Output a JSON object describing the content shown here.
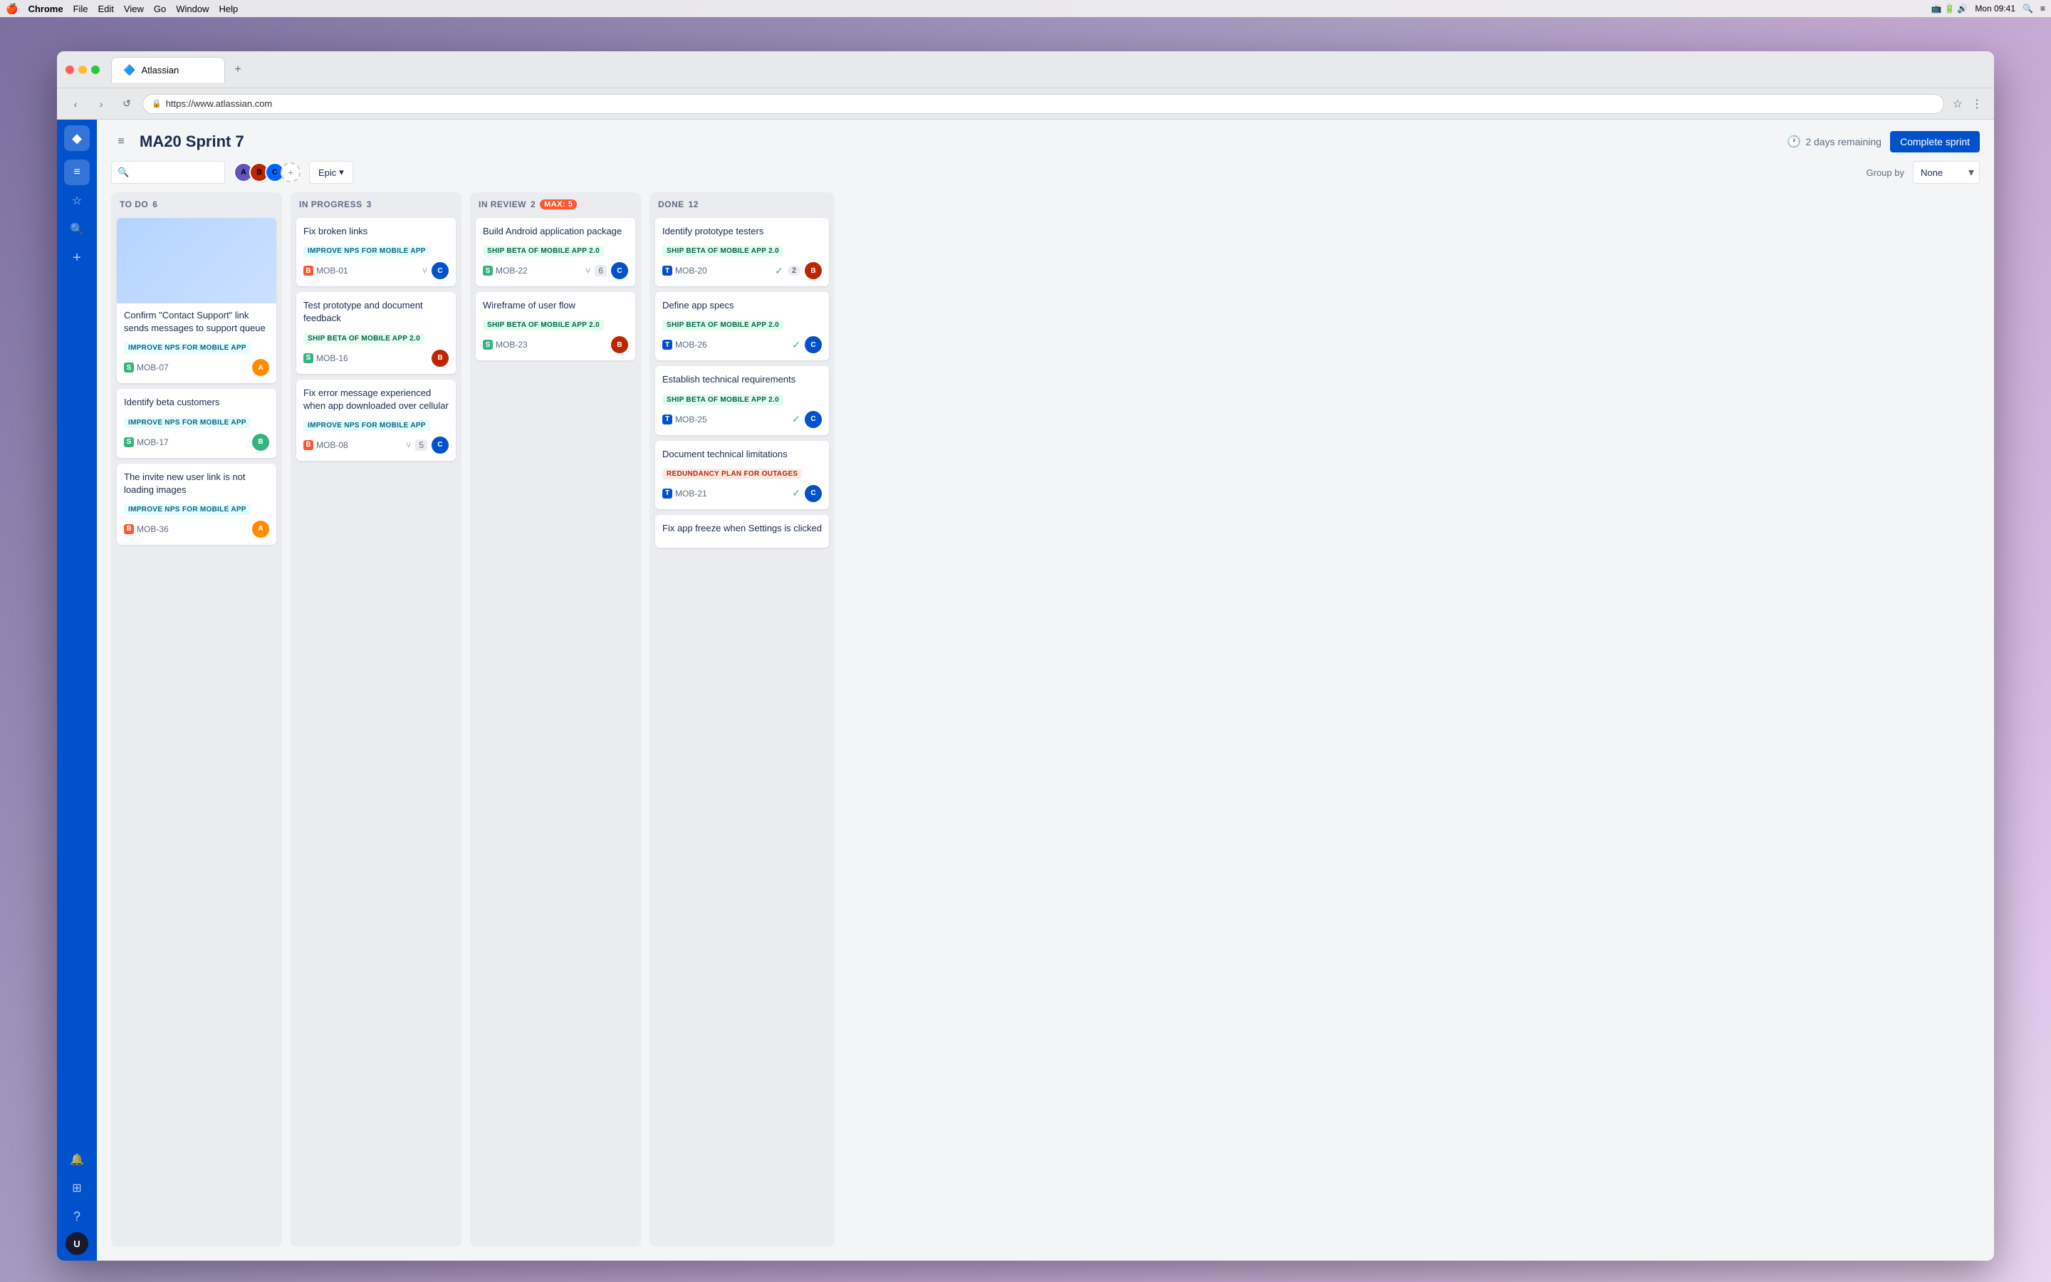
{
  "menubar": {
    "apple": "🍎",
    "app_name": "Chrome",
    "menus": [
      "File",
      "Edit",
      "View",
      "Go",
      "Window",
      "Help"
    ],
    "time": "Mon 09:41"
  },
  "browser": {
    "tab_label": "Atlassian",
    "tab_icon": "🔷",
    "url": "https://www.atlassian.com",
    "new_tab_label": "+"
  },
  "sprint": {
    "title": "MA20 Sprint 7",
    "remaining": "2 days remaining",
    "complete_btn": "Complete sprint",
    "group_by_label": "Group by",
    "group_by_value": "None",
    "epic_filter": "Epic"
  },
  "columns": {
    "todo": {
      "label": "TO DO",
      "count": "6"
    },
    "in_progress": {
      "label": "IN PROGRESS",
      "count": "3"
    },
    "in_review": {
      "label": "IN REVIEW",
      "count": "2",
      "max": "MAX: 5"
    },
    "done": {
      "label": "DONE",
      "count": "12"
    }
  },
  "todo_cards": [
    {
      "has_image": true,
      "title": "Confirm \"Contact Support\" link sends messages to support queue",
      "epic": "IMPROVE NPS FOR MOBILE APP",
      "epic_type": "improve",
      "issue_type": "story",
      "id": "MOB-07",
      "avatar_color": "#ff8b00"
    },
    {
      "has_image": false,
      "title": "Identify beta customers",
      "epic": "IMPROVE NPS FOR MOBILE APP",
      "epic_type": "improve",
      "issue_type": "story",
      "id": "MOB-17",
      "avatar_color": "#36b37e"
    },
    {
      "has_image": false,
      "title": "The invite new user link is not loading images",
      "epic": "IMPROVE NPS FOR MOBILE APP",
      "epic_type": "improve",
      "issue_type": "bug",
      "id": "MOB-36",
      "avatar_color": "#ff8b00"
    }
  ],
  "inprogress_cards": [
    {
      "title": "Fix broken links",
      "epic": "IMPROVE NPS FOR MOBILE APP",
      "epic_type": "improve",
      "issue_type": "bug",
      "id": "MOB-01",
      "story_points": null,
      "has_branch": true,
      "avatar_color": "#0052cc"
    },
    {
      "title": "Test prototype and document feedback",
      "epic": "SHIP BETA OF MOBILE APP 2.0",
      "epic_type": "ship",
      "issue_type": "story",
      "id": "MOB-16",
      "story_points": null,
      "has_branch": false,
      "avatar_color": "#bf2600"
    },
    {
      "title": "Fix error message experienced when app downloaded over cellular",
      "epic": "IMPROVE NPS FOR MOBILE APP",
      "epic_type": "improve",
      "issue_type": "bug",
      "id": "MOB-08",
      "story_points": "5",
      "has_branch": true,
      "avatar_color": "#0052cc"
    }
  ],
  "inreview_cards": [
    {
      "title": "Build Android application package",
      "epic": "SHIP BETA OF MOBILE APP 2.0",
      "epic_type": "ship",
      "issue_type": "story",
      "id": "MOB-22",
      "story_points": "6",
      "avatar_color": "#0052cc"
    },
    {
      "title": "Wireframe of user flow",
      "epic": "SHIP BETA OF MOBILE APP 2.0",
      "epic_type": "ship",
      "issue_type": "story",
      "id": "MOB-23",
      "story_points": null,
      "avatar_color": "#bf2600"
    }
  ],
  "done_cards": [
    {
      "title": "Identify prototype testers",
      "epic": "SHIP BETA OF MOBILE APP 2.0",
      "epic_type": "ship",
      "issue_type": "task",
      "id": "MOB-20",
      "check_count": "2",
      "avatar_color": "#bf2600"
    },
    {
      "title": "Define app specs",
      "epic": "SHIP BETA OF MOBILE APP 2.0",
      "epic_type": "ship",
      "issue_type": "task",
      "id": "MOB-26",
      "check_count": null,
      "avatar_color": "#0052cc"
    },
    {
      "title": "Establish technical requirements",
      "epic": "SHIP BETA OF MOBILE APP 2.0",
      "epic_type": "ship",
      "issue_type": "task",
      "id": "MOB-25",
      "check_count": null,
      "avatar_color": "#0052cc"
    },
    {
      "title": "Document technical limitations",
      "epic": "REDUNDANCY PLAN FOR OUTAGES",
      "epic_type": "redundancy",
      "issue_type": "task",
      "id": "MOB-21",
      "check_count": null,
      "avatar_color": "#0052cc"
    },
    {
      "title": "Fix app freeze when Settings is clicked",
      "epic": null,
      "epic_type": null,
      "issue_type": "bug",
      "id": null,
      "check_count": null,
      "avatar_color": null
    }
  ],
  "sidebar": {
    "logo": "◆",
    "items": [
      {
        "icon": "☆",
        "name": "favorites"
      },
      {
        "icon": "🔍",
        "name": "search"
      },
      {
        "icon": "+",
        "name": "create"
      }
    ],
    "bottom_items": [
      {
        "icon": "🔔",
        "name": "notifications"
      },
      {
        "icon": "⊞",
        "name": "apps"
      },
      {
        "icon": "?",
        "name": "help"
      }
    ]
  },
  "avatars": [
    {
      "color": "#6554c0",
      "initials": "A"
    },
    {
      "color": "#bf2600",
      "initials": "B"
    },
    {
      "color": "#0065ff",
      "initials": "C"
    }
  ]
}
